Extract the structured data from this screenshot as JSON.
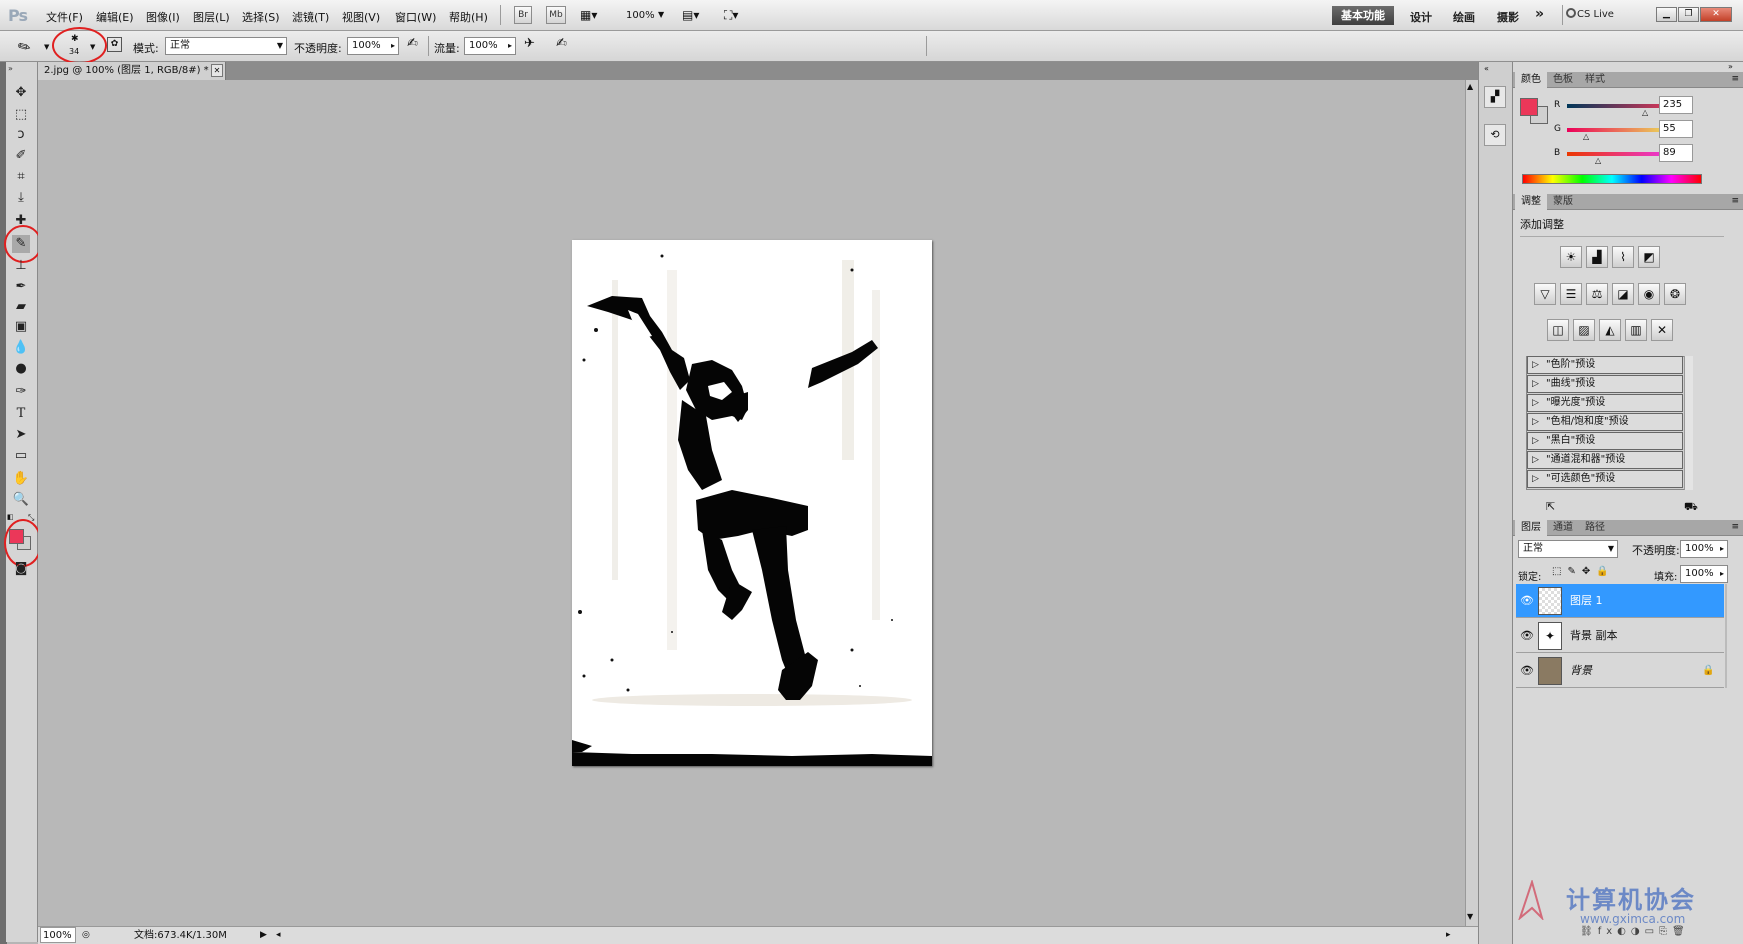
{
  "app": {
    "logo": "Ps"
  },
  "menu": [
    "文件(F)",
    "编辑(E)",
    "图像(I)",
    "图层(L)",
    "选择(S)",
    "滤镜(T)",
    "视图(V)",
    "窗口(W)",
    "帮助(H)"
  ],
  "appbar": {
    "br": "Br",
    "mb": "Mb",
    "zoom": "100%"
  },
  "workspaces": {
    "active": "基本功能",
    "items": [
      "设计",
      "绘画",
      "摄影"
    ],
    "more": "»",
    "cslive": "CS Live"
  },
  "window_buttons": {
    "min": "▁",
    "restore": "❐",
    "close": "✕"
  },
  "options": {
    "brush_size": "34",
    "mode_label": "模式:",
    "mode_value": "正常",
    "opacity_label": "不透明度:",
    "opacity_value": "100%",
    "flow_label": "流量:",
    "flow_value": "100%"
  },
  "document": {
    "tab_title": "2.jpg @ 100% (图层 1, RGB/8#) *",
    "tab_close": "✕",
    "status_zoom": "100%",
    "status_doc": "文档:673.4K/1.30M"
  },
  "colors": {
    "foreground": "#eb3759",
    "background": "#d0d0d0",
    "accent_selected": "#3399ff"
  },
  "color_panel": {
    "tabs": [
      "颜色",
      "色板",
      "样式"
    ],
    "channels": [
      {
        "label": "R",
        "value": "235"
      },
      {
        "label": "G",
        "value": "55"
      },
      {
        "label": "B",
        "value": "89"
      }
    ]
  },
  "adjust_panel": {
    "tabs": [
      "调整",
      "蒙版"
    ],
    "title": "添加调整",
    "icons": [
      "brightness-icon",
      "levels-icon",
      "curves-icon",
      "exposure-icon",
      "vibrance-icon",
      "hue-saturation-icon",
      "color-balance-icon",
      "black-white-icon",
      "photo-filter-icon",
      "channel-mixer-icon",
      "invert-icon",
      "posterize-icon",
      "threshold-icon",
      "gradient-map-icon",
      "selective-color-icon"
    ],
    "presets": [
      "\"色阶\"预设",
      "\"曲线\"预设",
      "\"曝光度\"预设",
      "\"色相/饱和度\"预设",
      "\"黑白\"预设",
      "\"通道混和器\"预设",
      "\"可选颜色\"预设"
    ]
  },
  "layers_panel": {
    "tabs": [
      "图层",
      "通道",
      "路径"
    ],
    "blend_mode": "正常",
    "opacity_label": "不透明度:",
    "opacity_value": "100%",
    "lock_label": "锁定:",
    "fill_label": "填充:",
    "fill_value": "100%",
    "layers": [
      {
        "name": "图层 1",
        "selected": true
      },
      {
        "name": "背景 副本",
        "selected": false
      },
      {
        "name": "背景",
        "selected": false,
        "locked": true
      }
    ]
  },
  "watermark": {
    "text": "计算机协会",
    "url": "www.gximca.com"
  }
}
